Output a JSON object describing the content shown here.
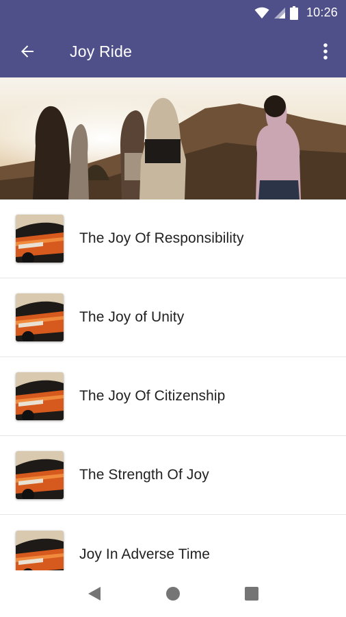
{
  "status_bar": {
    "time": "10:26",
    "icons": [
      "wifi-icon",
      "cell-signal-icon",
      "battery-icon"
    ]
  },
  "app_bar": {
    "title": "Joy Ride",
    "back_icon": "arrow-left-icon",
    "menu_icon": "more-vert-icon",
    "color": "#4f4f8a"
  },
  "hero": {
    "description_icon": "banner-image"
  },
  "episodes": [
    {
      "title": "The Joy Of Responsibility"
    },
    {
      "title": "The Joy of Unity"
    },
    {
      "title": "The Joy Of Citizenship"
    },
    {
      "title": "The Strength Of Joy"
    },
    {
      "title": "Joy In Adverse Time"
    }
  ],
  "nav_bar": {
    "icons": [
      "back-triangle-icon",
      "home-circle-icon",
      "recents-square-icon"
    ]
  }
}
